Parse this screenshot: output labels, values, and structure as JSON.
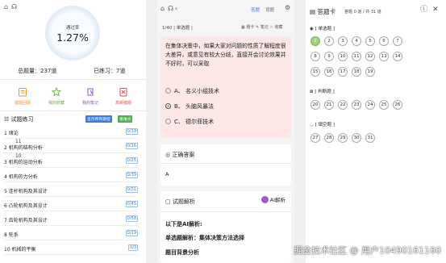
{
  "stats_panel": {
    "accuracy_label": "通过率",
    "accuracy_value": "1.27%",
    "total_label": "总题量：237道",
    "done_label": "已练习：7道",
    "feature_buttons": [
      {
        "label": "错题回顾",
        "icon": "notebook-icon"
      },
      {
        "label": "我的收藏",
        "icon": "star-icon"
      },
      {
        "label": "我的笔记",
        "icon": "note-icon"
      },
      {
        "label": "高频错题",
        "icon": "error-book-icon"
      }
    ],
    "section_title": "试题练习",
    "tags": [
      "显示所有题型",
      "重难点"
    ],
    "chapters": [
      {
        "name": "1 绪论",
        "count": "0/19"
      },
      {
        "name": "2 机构的结构分析",
        "count": "0/16"
      },
      {
        "name": "3 机构的运动分析",
        "count": "0/25"
      },
      {
        "name": "4 机构的力分析",
        "count": "0/39"
      },
      {
        "name": "5 连杆机构及其设计",
        "count": "0/31"
      },
      {
        "name": "6 凸轮机构及其设计",
        "count": "0/45"
      },
      {
        "name": "7 齿轮机构及其设计",
        "count": "0/58"
      },
      {
        "name": "8 轮系",
        "count": "0/19"
      },
      {
        "name": "10 机械的平衡",
        "count": "0/3"
      }
    ],
    "chapter_sups": [
      "",
      "11",
      "10",
      "",
      "",
      "",
      "",
      "",
      ""
    ]
  },
  "question_panel": {
    "top_tabs": [
      "答题",
      "背题"
    ],
    "progress": "1/40 | 单选题 |",
    "toolbar": [
      "题卡",
      "笔记",
      "收藏"
    ],
    "question": "在集体决策中，如果大家对问题的性质了解程度很大差异，或意见有较大分歧，直接开会讨论效果并不好时，可以采取",
    "options": [
      {
        "text": "A、 名义小组技术",
        "selected": false
      },
      {
        "text": "B、 头脑风暴法",
        "selected": true
      },
      {
        "text": "C、 德尔菲技术",
        "selected": false
      }
    ],
    "answer_title": "正确答案",
    "answer": "A",
    "analysis_title": "试题解析",
    "ai_button": "AI解析",
    "ai_heading": "以下是AI解析:",
    "ai_line1": "单选题解析：集体决策方法选择",
    "ai_line2": "题目背景分析"
  },
  "card_panel": {
    "title": "答题卡",
    "summary": "答题 0 道 / 共 31 道",
    "sections": [
      {
        "name": "[ 单选题 ]",
        "numbers": [
          "1",
          "2",
          "3",
          "4",
          "5",
          "6",
          "7",
          "8",
          "9",
          "10",
          "11",
          "12",
          "13",
          "14",
          "15",
          "16",
          "17",
          "18",
          "19"
        ]
      },
      {
        "name": "[ 判断题 ]",
        "numbers": [
          "20",
          "21",
          "22",
          "23",
          "24",
          "25",
          "26"
        ]
      },
      {
        "name": "[ 填空题 ]",
        "numbers": [
          "27",
          "28",
          "29",
          "30",
          "31"
        ]
      }
    ],
    "active_number": "1"
  },
  "watermark": "掘金技术社区 @ 用户10490161160",
  "colors": {
    "accent": "#3c7bd8",
    "question_bg": "#fde7e7",
    "active_circle": "#a4d27e",
    "ai_purple": "#9b59d0"
  }
}
